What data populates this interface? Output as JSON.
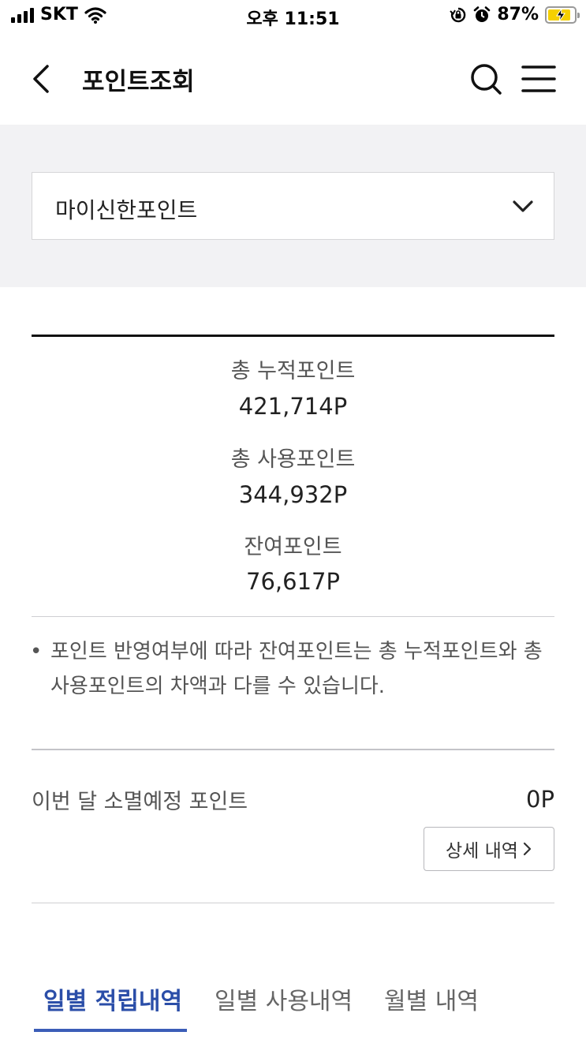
{
  "status_bar": {
    "carrier": "SKT",
    "time": "오후 11:51",
    "battery_percent": "87%",
    "battery_level": 0.87,
    "icons": [
      "signal-icon",
      "wifi-icon",
      "orientation-lock-icon",
      "alarm-icon",
      "battery-icon",
      "charging-bolt-icon"
    ]
  },
  "header": {
    "title": "포인트조회",
    "icons": [
      "back-chevron-icon",
      "search-icon",
      "hamburger-menu-icon"
    ]
  },
  "point_select": {
    "selected": "마이신한포인트",
    "icon": "chevron-down-icon"
  },
  "summary": {
    "total_accumulated_label": "총 누적포인트",
    "total_accumulated_value": "421,714P",
    "total_used_label": "총 사용포인트",
    "total_used_value": "344,932P",
    "remaining_label": "잔여포인트",
    "remaining_value": "76,617P"
  },
  "note": {
    "bullet": "•",
    "text": "포인트 반영여부에 따라 잔여포인트는 총 누적포인트와 총 사용포인트의 차액과 다를 수 있습니다."
  },
  "expiring": {
    "label": "이번 달 소멸예정 포인트",
    "value": "0P",
    "detail_button": "상세 내역",
    "detail_icon": "chevron-right-icon"
  },
  "tabs": [
    {
      "label": "일별 적립내역",
      "active": true
    },
    {
      "label": "일별 사용내역",
      "active": false
    },
    {
      "label": "월별 내역",
      "active": false
    }
  ],
  "colors": {
    "accent": "#2b4ea8",
    "gray_background": "#f2f2f4",
    "battery_fill": "#f5d000"
  }
}
